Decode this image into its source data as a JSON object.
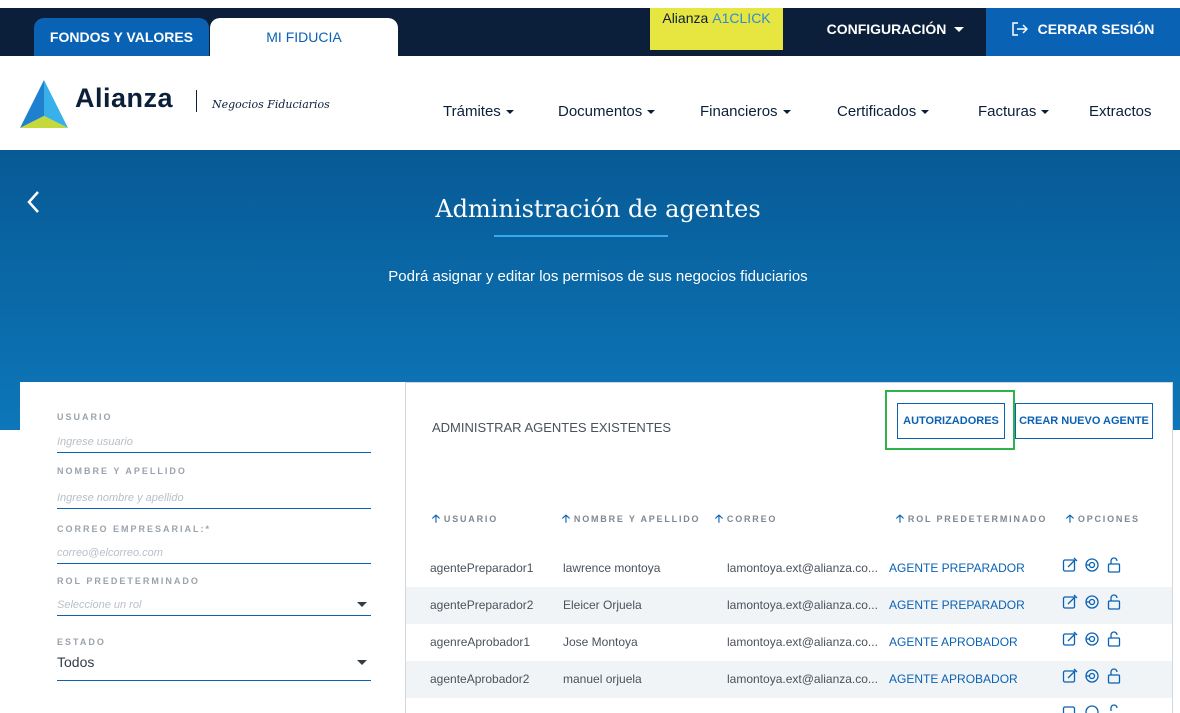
{
  "topbar": {
    "tab_fondos": "FONDOS Y VALORES",
    "tab_fiducia": "MI FIDUCIA",
    "aclick_prefix": "Alianza",
    "aclick_brand": "A1CLICK",
    "config_label": "CONFIGURACIÓN",
    "logout_label": "CERRAR SESIÓN"
  },
  "brand": {
    "logo_text": "Alianza",
    "subtitle": "Negocios Fiduciarios"
  },
  "nav": {
    "items": [
      {
        "label": "Trámites",
        "dropdown": true
      },
      {
        "label": "Documentos",
        "dropdown": true
      },
      {
        "label": "Financieros",
        "dropdown": true
      },
      {
        "label": "Certificados",
        "dropdown": true
      },
      {
        "label": "Facturas",
        "dropdown": true
      },
      {
        "label": "Extractos",
        "dropdown": false
      }
    ]
  },
  "hero": {
    "title": "Administración de agentes",
    "subtitle": "Podrá asignar y editar los permisos de sus negocios fiduciarios"
  },
  "filters": {
    "usuario_label": "USUARIO",
    "usuario_placeholder": "Ingrese usuario",
    "nombre_label": "NOMBRE Y APELLIDO",
    "nombre_placeholder": "Ingrese nombre y apellido",
    "correo_label": "CORREO EMPRESARIAL:*",
    "correo_placeholder": "correo@elcorreo.com",
    "rol_label": "ROL PREDETERMINADO",
    "rol_placeholder": "Seleccione un rol",
    "estado_label": "ESTADO",
    "estado_value": "Todos"
  },
  "panel": {
    "title": "ADMINISTRAR AGENTES EXISTENTES",
    "btn_autorizadores": "AUTORIZADORES",
    "btn_crear": "CREAR NUEVO AGENTE",
    "columns": [
      "USUARIO",
      "NOMBRE Y APELLIDO",
      "CORREO",
      "ROL PREDETERMINADO",
      "OPCIONES"
    ],
    "rows": [
      {
        "usuario": "agentePreparador1",
        "nombre": "lawrence montoya",
        "correo": "lamontoya.ext@alianza.co...",
        "rol": "AGENTE PREPARADOR"
      },
      {
        "usuario": "agentePreparador2",
        "nombre": "Eleicer Orjuela",
        "correo": "lamontoya.ext@alianza.co...",
        "rol": "AGENTE PREPARADOR"
      },
      {
        "usuario": "agenreAprobador1",
        "nombre": "Jose Montoya",
        "correo": "lamontoya.ext@alianza.co...",
        "rol": "AGENTE APROBADOR"
      },
      {
        "usuario": "agenteAprobador2",
        "nombre": "manuel orjuela",
        "correo": "lamontoya.ext@alianza.co...",
        "rol": "AGENTE APROBADOR"
      }
    ]
  },
  "colors": {
    "navy": "#0b1f3a",
    "blue": "#0a62b5",
    "hero_top": "#075a95",
    "hero_bottom": "#0d77b9",
    "aclick_yellow": "#e7e540",
    "highlight_green": "#2db34a"
  }
}
